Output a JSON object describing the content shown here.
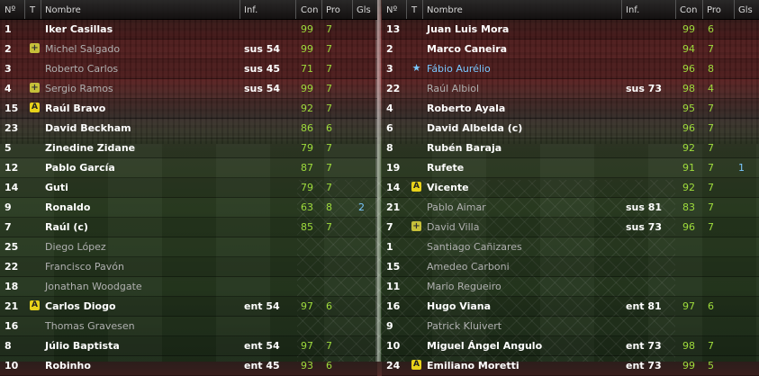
{
  "headers": {
    "num": "Nº",
    "t": "T",
    "name": "Nombre",
    "inf": "Inf.",
    "con": "Con",
    "pro": "Pro",
    "gls": "Gls"
  },
  "colors": {
    "value_green": "#9fdc3c",
    "goals_blue": "#7ac8ff",
    "tag_yellow": "#e8d21a"
  },
  "left": [
    {
      "num": "1",
      "tag": "",
      "name": "Iker Casillas",
      "inf": "",
      "con": "99",
      "pro": "7",
      "gls": "",
      "dim": false
    },
    {
      "num": "2",
      "tag": "plus-icon",
      "name": "Michel Salgado",
      "inf": "sus 54",
      "con": "99",
      "pro": "7",
      "gls": "",
      "dim": true
    },
    {
      "num": "3",
      "tag": "",
      "name": "Roberto Carlos",
      "inf": "sus 45",
      "con": "71",
      "pro": "7",
      "gls": "",
      "dim": true
    },
    {
      "num": "4",
      "tag": "plus-icon",
      "name": "Sergio Ramos",
      "inf": "sus 54",
      "con": "99",
      "pro": "7",
      "gls": "",
      "dim": true
    },
    {
      "num": "15",
      "tag": "a-icon",
      "name": "Raúl Bravo",
      "inf": "",
      "con": "92",
      "pro": "7",
      "gls": "",
      "dim": false
    },
    {
      "num": "23",
      "tag": "",
      "name": "David Beckham",
      "inf": "",
      "con": "86",
      "pro": "6",
      "gls": "",
      "dim": false
    },
    {
      "num": "5",
      "tag": "",
      "name": "Zinedine Zidane",
      "inf": "",
      "con": "79",
      "pro": "7",
      "gls": "",
      "dim": false
    },
    {
      "num": "12",
      "tag": "",
      "name": "Pablo García",
      "inf": "",
      "con": "87",
      "pro": "7",
      "gls": "",
      "dim": false
    },
    {
      "num": "14",
      "tag": "",
      "name": "Guti",
      "inf": "",
      "con": "79",
      "pro": "7",
      "gls": "",
      "dim": false
    },
    {
      "num": "9",
      "tag": "",
      "name": "Ronaldo",
      "inf": "",
      "con": "63",
      "pro": "8",
      "gls": "2",
      "dim": false
    },
    {
      "num": "7",
      "tag": "",
      "name": "Raúl (c)",
      "inf": "",
      "con": "85",
      "pro": "7",
      "gls": "",
      "dim": false
    },
    {
      "num": "25",
      "tag": "",
      "name": "Diego López",
      "inf": "",
      "con": "",
      "pro": "",
      "gls": "",
      "dim": true
    },
    {
      "num": "22",
      "tag": "",
      "name": "Francisco Pavón",
      "inf": "",
      "con": "",
      "pro": "",
      "gls": "",
      "dim": true
    },
    {
      "num": "18",
      "tag": "",
      "name": "Jonathan Woodgate",
      "inf": "",
      "con": "",
      "pro": "",
      "gls": "",
      "dim": true
    },
    {
      "num": "21",
      "tag": "a-icon",
      "name": "Carlos Diogo",
      "inf": "ent 54",
      "con": "97",
      "pro": "6",
      "gls": "",
      "dim": false
    },
    {
      "num": "16",
      "tag": "",
      "name": "Thomas Gravesen",
      "inf": "",
      "con": "",
      "pro": "",
      "gls": "",
      "dim": true
    },
    {
      "num": "8",
      "tag": "",
      "name": "Júlio Baptista",
      "inf": "ent 54",
      "con": "97",
      "pro": "7",
      "gls": "",
      "dim": false
    },
    {
      "num": "10",
      "tag": "",
      "name": "Robinho",
      "inf": "ent 45",
      "con": "93",
      "pro": "6",
      "gls": "",
      "dim": false
    }
  ],
  "right": [
    {
      "num": "13",
      "tag": "",
      "name": "Juan Luis Mora",
      "inf": "",
      "con": "99",
      "pro": "6",
      "gls": "",
      "dim": false
    },
    {
      "num": "2",
      "tag": "",
      "name": "Marco Caneira",
      "inf": "",
      "con": "94",
      "pro": "7",
      "gls": "",
      "dim": false
    },
    {
      "num": "3",
      "tag": "star-icon",
      "name": "Fábio Aurélio",
      "inf": "",
      "con": "96",
      "pro": "8",
      "gls": "",
      "dim": false,
      "blue": true
    },
    {
      "num": "22",
      "tag": "",
      "name": "Raúl Albiol",
      "inf": "sus 73",
      "con": "98",
      "pro": "4",
      "gls": "",
      "dim": true
    },
    {
      "num": "4",
      "tag": "",
      "name": "Roberto Ayala",
      "inf": "",
      "con": "95",
      "pro": "7",
      "gls": "",
      "dim": false
    },
    {
      "num": "6",
      "tag": "",
      "name": "David Albelda (c)",
      "inf": "",
      "con": "96",
      "pro": "7",
      "gls": "",
      "dim": false
    },
    {
      "num": "8",
      "tag": "",
      "name": "Rubén Baraja",
      "inf": "",
      "con": "92",
      "pro": "7",
      "gls": "",
      "dim": false
    },
    {
      "num": "19",
      "tag": "",
      "name": "Rufete",
      "inf": "",
      "con": "91",
      "pro": "7",
      "gls": "1",
      "dim": false
    },
    {
      "num": "14",
      "tag": "a-icon",
      "name": "Vicente",
      "inf": "",
      "con": "92",
      "pro": "7",
      "gls": "",
      "dim": false
    },
    {
      "num": "21",
      "tag": "",
      "name": "Pablo Aimar",
      "inf": "sus 81",
      "con": "83",
      "pro": "7",
      "gls": "",
      "dim": true
    },
    {
      "num": "7",
      "tag": "plus-icon",
      "name": "David Villa",
      "inf": "sus 73",
      "con": "96",
      "pro": "7",
      "gls": "",
      "dim": true
    },
    {
      "num": "1",
      "tag": "",
      "name": "Santiago Cañizares",
      "inf": "",
      "con": "",
      "pro": "",
      "gls": "",
      "dim": true
    },
    {
      "num": "15",
      "tag": "",
      "name": "Amedeo Carboni",
      "inf": "",
      "con": "",
      "pro": "",
      "gls": "",
      "dim": true
    },
    {
      "num": "11",
      "tag": "",
      "name": "Mario Regueiro",
      "inf": "",
      "con": "",
      "pro": "",
      "gls": "",
      "dim": true
    },
    {
      "num": "16",
      "tag": "",
      "name": "Hugo Viana",
      "inf": "ent 81",
      "con": "97",
      "pro": "6",
      "gls": "",
      "dim": false
    },
    {
      "num": "9",
      "tag": "",
      "name": "Patrick Kluivert",
      "inf": "",
      "con": "",
      "pro": "",
      "gls": "",
      "dim": true
    },
    {
      "num": "10",
      "tag": "",
      "name": "Miguel Ángel Angulo",
      "inf": "ent 73",
      "con": "98",
      "pro": "7",
      "gls": "",
      "dim": false
    },
    {
      "num": "24",
      "tag": "a-icon",
      "name": "Emiliano Moretti",
      "inf": "ent 73",
      "con": "99",
      "pro": "5",
      "gls": "",
      "dim": false
    }
  ]
}
